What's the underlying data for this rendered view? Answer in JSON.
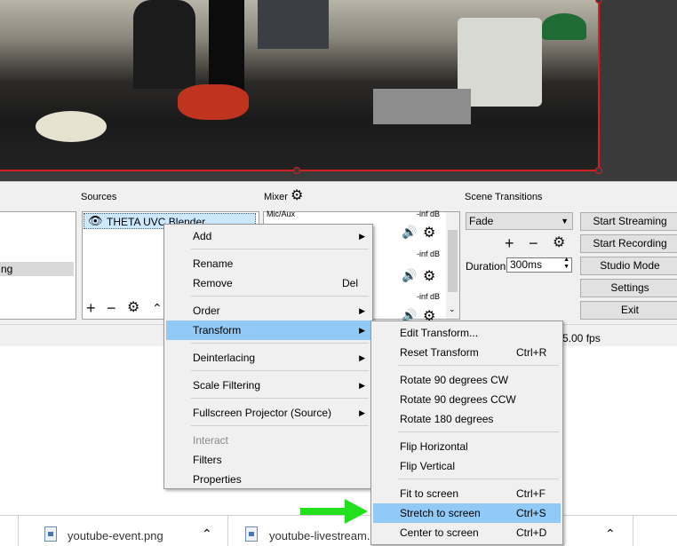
{
  "docks": {
    "sources_title": "Sources",
    "mixer_title": "Mixer",
    "transitions_title": "Scene Transitions"
  },
  "scenes": {
    "selected_label": "ng"
  },
  "sources": {
    "items": [
      {
        "label": "THETA UVC Blender"
      }
    ]
  },
  "mixer": {
    "channels": [
      {
        "label": "Mic/Aux",
        "level": "-inf dB"
      },
      {
        "label": "",
        "level": "-inf dB"
      },
      {
        "label": "",
        "level": "-inf dB"
      }
    ]
  },
  "transitions": {
    "selected": "Fade",
    "duration_label": "Duration",
    "duration_value": "300ms"
  },
  "controls": {
    "start_streaming": "Start Streaming",
    "start_recording": "Start Recording",
    "studio_mode": "Studio Mode",
    "settings": "Settings",
    "exit": "Exit"
  },
  "status": {
    "fps": "5.00 fps"
  },
  "context_menu": {
    "add": "Add",
    "rename": "Rename",
    "remove": "Remove",
    "remove_shortcut": "Del",
    "order": "Order",
    "transform": "Transform",
    "deinterlacing": "Deinterlacing",
    "scale_filtering": "Scale Filtering",
    "fullscreen_projector": "Fullscreen Projector (Source)",
    "interact": "Interact",
    "filters": "Filters",
    "properties": "Properties"
  },
  "transform_menu": {
    "edit_transform": "Edit Transform...",
    "reset_transform": "Reset Transform",
    "reset_transform_shortcut": "Ctrl+R",
    "rotate_cw": "Rotate 90 degrees CW",
    "rotate_ccw": "Rotate 90 degrees CCW",
    "rotate_180": "Rotate 180 degrees",
    "flip_horizontal": "Flip Horizontal",
    "flip_vertical": "Flip Vertical",
    "fit_to_screen": "Fit to screen",
    "fit_to_screen_shortcut": "Ctrl+F",
    "stretch_to_screen": "Stretch to screen",
    "stretch_to_screen_shortcut": "Ctrl+S",
    "center_to_screen": "Center to screen",
    "center_to_screen_shortcut": "Ctrl+D"
  },
  "downloads": [
    {
      "name": "youtube-event.png"
    },
    {
      "name": "youtube-livestream.png"
    }
  ],
  "colors": {
    "highlight": "#91c9f7",
    "selection_border": "#d42020",
    "arrow": "#22e01e"
  }
}
